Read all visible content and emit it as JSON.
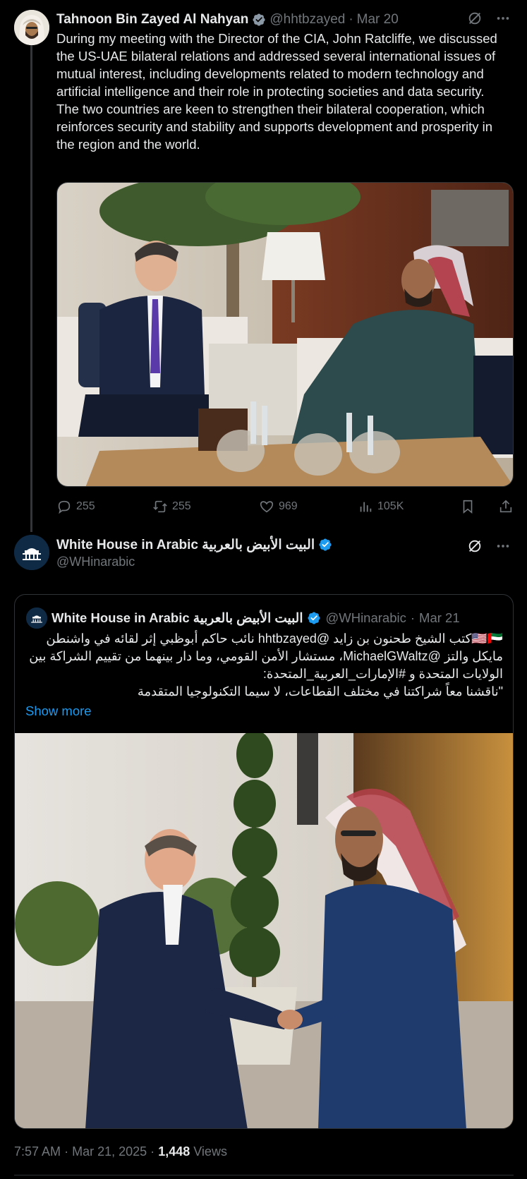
{
  "tweet1": {
    "name": "Tahnoon Bin Zayed Al Nahyan",
    "handle": "@hhtbzayed",
    "dot": "·",
    "date": "Mar 20",
    "text": "During my meeting with the Director of the CIA, John Ratcliffe, we discussed the US-UAE bilateral relations and addressed several international issues of mutual interest, including developments related to modern technology and artificial intelligence and their role in protecting societies and data security.\nThe two countries are keen to strengthen their bilateral cooperation, which reinforces security and stability and supports development and prosperity in the region and the world.",
    "stats": {
      "replies": "255",
      "reposts": "255",
      "likes": "969",
      "views": "105K"
    }
  },
  "tweet2": {
    "name": "White House in Arabic البيت الأبيض بالعربية",
    "handle": "@WHinarabic",
    "quote": {
      "name": "White House in Arabic البيت الأبيض بالعربية",
      "handle": "@WHinarabic",
      "dot": "·",
      "date": "Mar 21",
      "text": "🇺🇸🇦🇪كتب الشيخ طحنون بن زايد @hhtbzayed نائب حاكم أبوظبي إثر لقائه في واشنطن مايكل والتز @MichaelGWaltz، مستشار الأمن القومي، وما دار بينهما من تقييم الشراكة بين الولايات المتحدة و #الإمارات_العربية_المتحدة:\n\"ناقشنا معاً شراكتنا في مختلف القطاعات، لا سيما التكنولوجيا المتقدمة",
      "show_more": "Show more"
    },
    "footer": {
      "time": "7:57 AM",
      "sep1": "·",
      "date": "Mar 21, 2025",
      "sep2": "·",
      "views_count": "1,448",
      "views_label": "Views"
    }
  },
  "colors": {
    "background": "#000000",
    "text": "#e7e9ea",
    "muted": "#71767b",
    "accent": "#1d9bf0",
    "border": "#2f3336"
  }
}
